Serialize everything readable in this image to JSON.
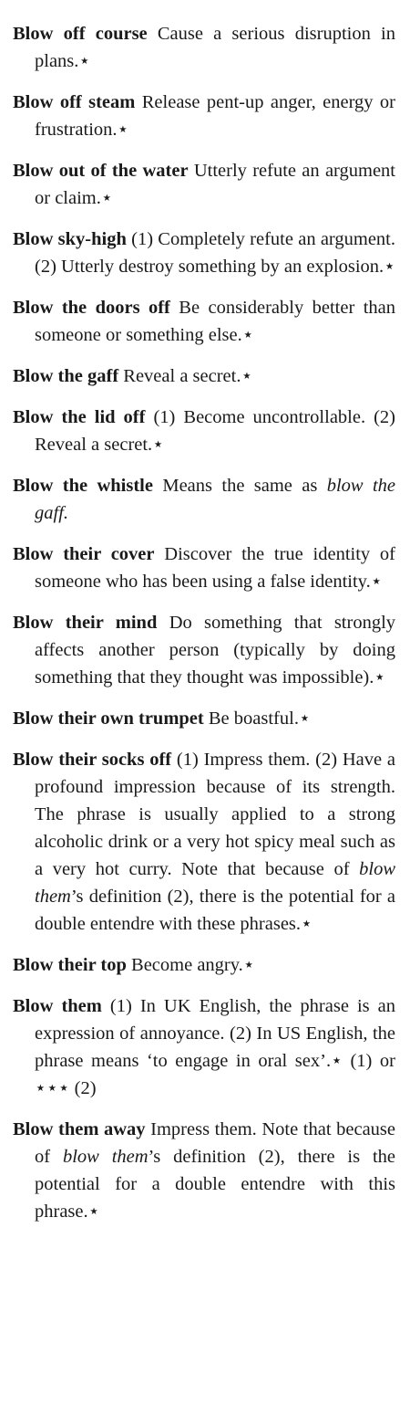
{
  "entries": [
    {
      "headword": "Blow off course",
      "definition": "Cause a serious disruption in plans.⋆"
    },
    {
      "headword": "Blow off steam",
      "definition": "Release pent-up anger, energy or frustration.⋆"
    },
    {
      "headword": "Blow out of the water",
      "definition": "Utterly refute an argument or claim.⋆"
    },
    {
      "headword": "Blow sky-high",
      "definition": "(1) Completely refute an argument. (2) Utterly destroy something by an explosion.⋆"
    },
    {
      "headword": "Blow the doors off",
      "definition": "Be considerably better than someone or something else.⋆"
    },
    {
      "headword": "Blow the gaff",
      "definition": "Reveal a secret.⋆"
    },
    {
      "headword": "Blow the lid off",
      "definition": "(1) Become uncontrollable. (2) Reveal a secret.⋆"
    },
    {
      "headword": "Blow the whistle",
      "definition_prefix": "Means the same as",
      "definition_italic": "blow the gaff."
    },
    {
      "headword": "Blow their cover",
      "definition": "Discover the true identity of someone who has been using a false identity.⋆"
    },
    {
      "headword": "Blow their mind",
      "definition": "Do something that strongly affects another person (typically by doing something that they thought was impossible).⋆"
    },
    {
      "headword": "Blow their own trumpet",
      "definition": "Be boastful.⋆"
    },
    {
      "headword": "Blow their socks off",
      "definition_a": "(1) Impress them. (2) Have a profound impression because of its strength. The phrase is usually applied to a strong alcoholic drink or a very hot spicy meal such as a very hot curry. Note that because of",
      "definition_italic": "blow them",
      "definition_b": "’s definition (2), there is the potential for a double entendre with these phrases.⋆"
    },
    {
      "headword": "Blow their top",
      "definition": "Become angry.⋆"
    },
    {
      "headword": "Blow them",
      "definition": "(1) In UK English, the phrase is an expression of annoyance. (2) In US English, the phrase means ‘to engage in oral sex’.⋆ (1) or ⋆⋆⋆ (2)"
    },
    {
      "headword": "Blow them away",
      "definition_a": "Impress them. Note that because of",
      "definition_italic": "blow them",
      "definition_b": "’s definition (2), there is the potential for a double entendre with this phrase.⋆"
    }
  ]
}
